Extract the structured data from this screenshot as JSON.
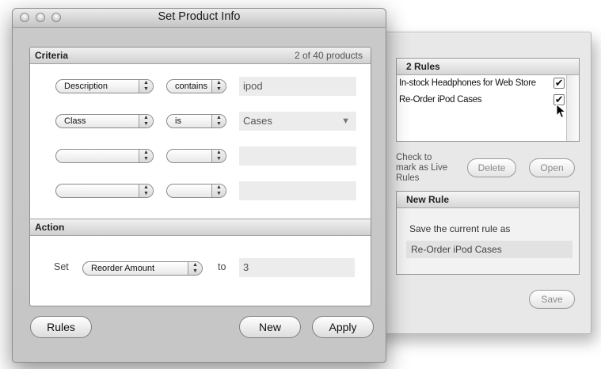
{
  "window": {
    "title": "Set Product Info"
  },
  "criteria": {
    "header": "Criteria",
    "count": "2 of 40 products",
    "rows": [
      {
        "field": "Description",
        "operator": "contains",
        "value": "ipod"
      },
      {
        "field": "Class",
        "operator": "is",
        "value": "Cases"
      },
      {
        "field": "",
        "operator": "",
        "value": ""
      },
      {
        "field": "",
        "operator": "",
        "value": ""
      }
    ]
  },
  "action": {
    "header": "Action",
    "set_label": "Set",
    "field": "Reorder Amount",
    "to_label": "to",
    "value": "3"
  },
  "buttons": {
    "rules": "Rules",
    "new": "New",
    "apply": "Apply"
  },
  "drawer": {
    "rules_header": "2 Rules",
    "rules": [
      {
        "name": "In-stock Headphones for Web Store",
        "checked": true
      },
      {
        "name": "Re-Order iPod Cases",
        "checked": true
      }
    ],
    "hint": "Check to mark as Live Rules",
    "delete_label": "Delete",
    "open_label": "Open",
    "new_rule_header": "New Rule",
    "save_as_label": "Save the current rule as",
    "save_as_value": "Re-Order iPod Cases",
    "save_label": "Save"
  },
  "icons": {
    "check": "✔",
    "stepper_up": "▲",
    "stepper_down": "▼",
    "dropdown": "▼"
  }
}
